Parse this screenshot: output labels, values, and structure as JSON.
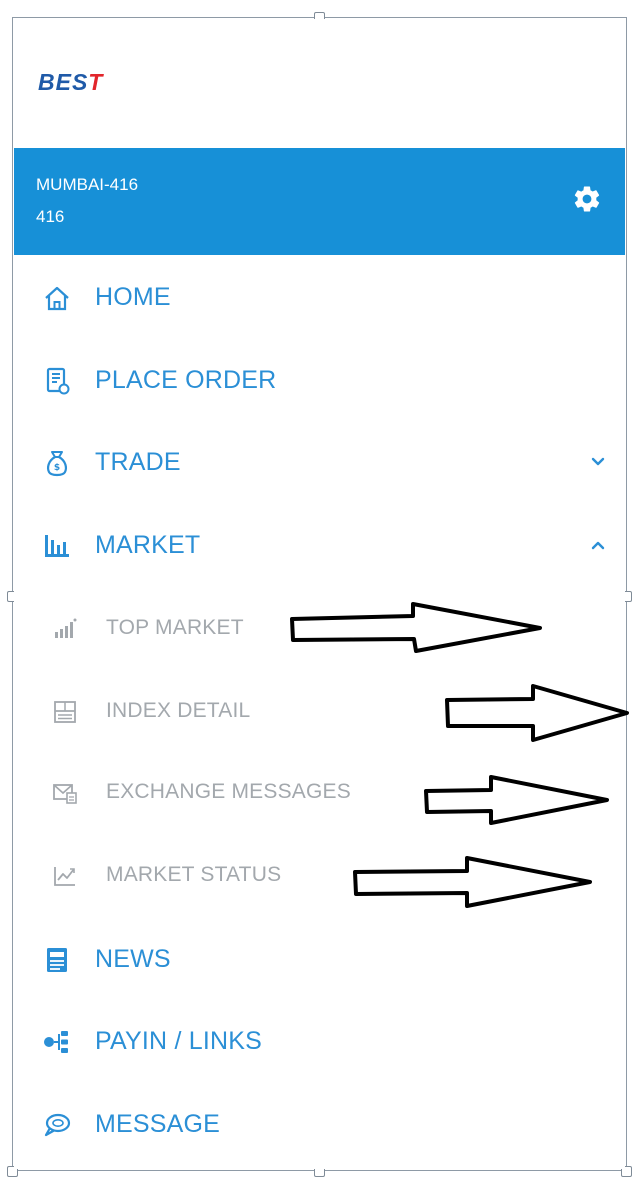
{
  "brand": {
    "logo_main": "BES",
    "logo_accent": "T"
  },
  "account": {
    "name": "MUMBAI-416",
    "code": "416"
  },
  "menu": [
    {
      "label": "HOME",
      "icon": "home-icon"
    },
    {
      "label": "PLACE ORDER",
      "icon": "order-receipt-icon"
    },
    {
      "label": "TRADE",
      "icon": "money-bag-icon",
      "chevron": "chevron-down-icon"
    },
    {
      "label": "MARKET",
      "icon": "bar-chart-icon",
      "chevron": "chevron-up-icon",
      "expanded": true
    }
  ],
  "market_submenu": [
    {
      "label": "TOP MARKET",
      "icon": "signal-bars-icon"
    },
    {
      "label": "INDEX DETAIL",
      "icon": "index-grid-icon"
    },
    {
      "label": "EXCHANGE MESSAGES",
      "icon": "envelope-icon"
    },
    {
      "label": "MARKET STATUS",
      "icon": "trend-chart-icon"
    }
  ],
  "menu_bottom": [
    {
      "label": "NEWS",
      "icon": "news-document-icon"
    },
    {
      "label": "PAYIN / LINKS",
      "icon": "links-tree-icon"
    },
    {
      "label": "MESSAGE",
      "icon": "chat-bubble-icon"
    }
  ],
  "colors": {
    "accent": "#1790d7",
    "menu_text": "#2b8fd6",
    "submenu_text": "#a3a8ad",
    "annotation_arrow": "#000000"
  }
}
